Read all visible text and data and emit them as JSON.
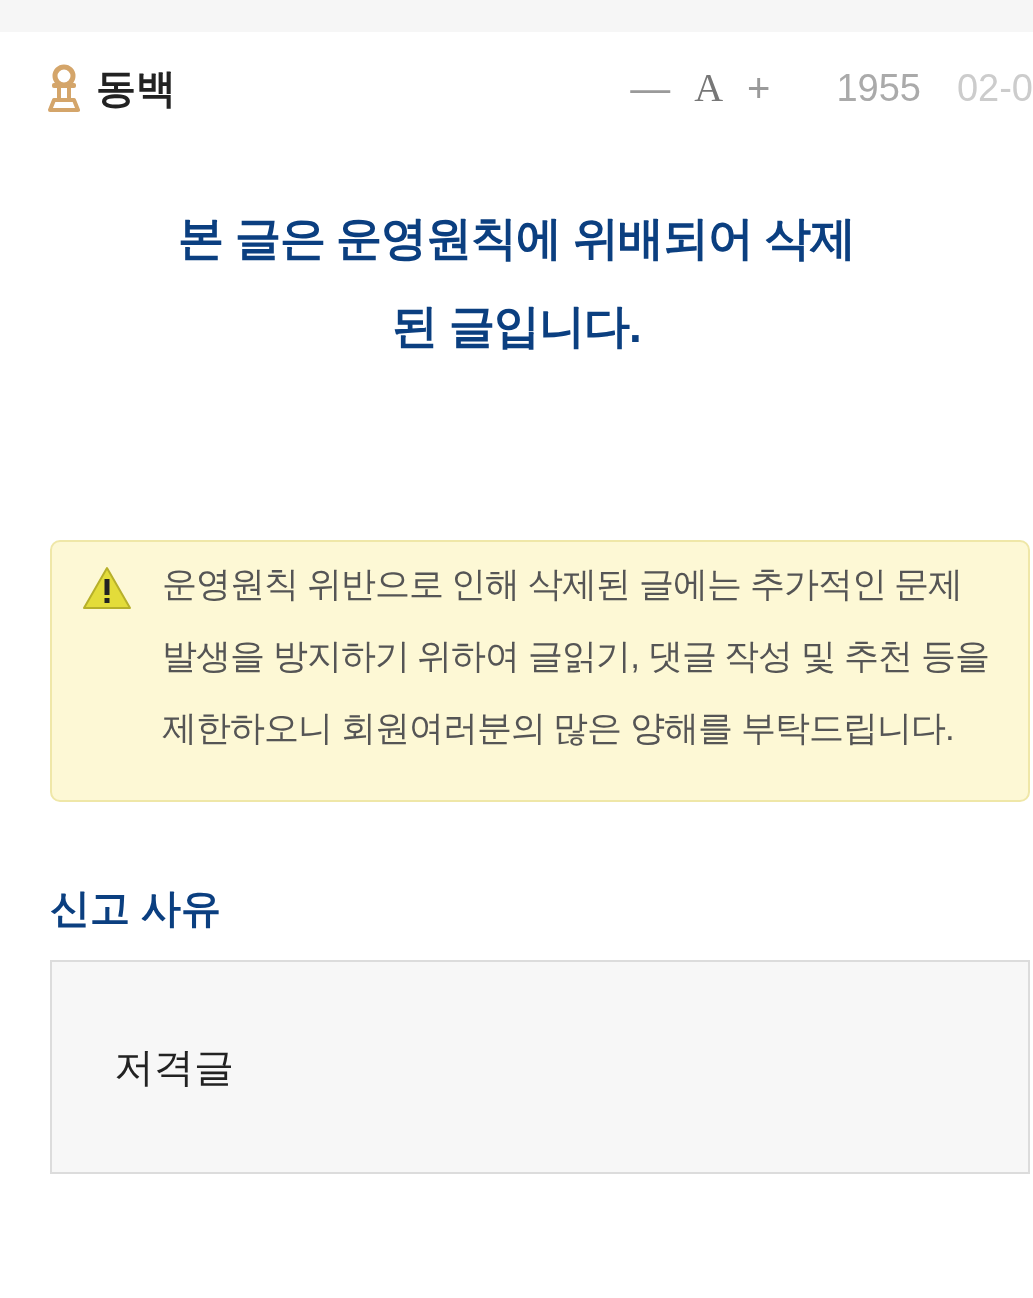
{
  "header": {
    "author": "동백",
    "font_controls": [
      "—",
      "A",
      "+"
    ],
    "views": "1955",
    "date": "02-0"
  },
  "notice": {
    "lines": [
      "본 글은 운영원칙에 위배되어 삭제",
      "된 글입니다."
    ]
  },
  "warning": {
    "text": "운영원칙 위반으로 인해 삭제된 글에는 추가적인 문제 발생을 방지하기 위하여 글읽기, 댓글 작성 및 추천 등을 제한하오니 회원여러분의 많은 양해를 부탁드립니다."
  },
  "report": {
    "title": "신고 사유",
    "reason": "저격글"
  }
}
